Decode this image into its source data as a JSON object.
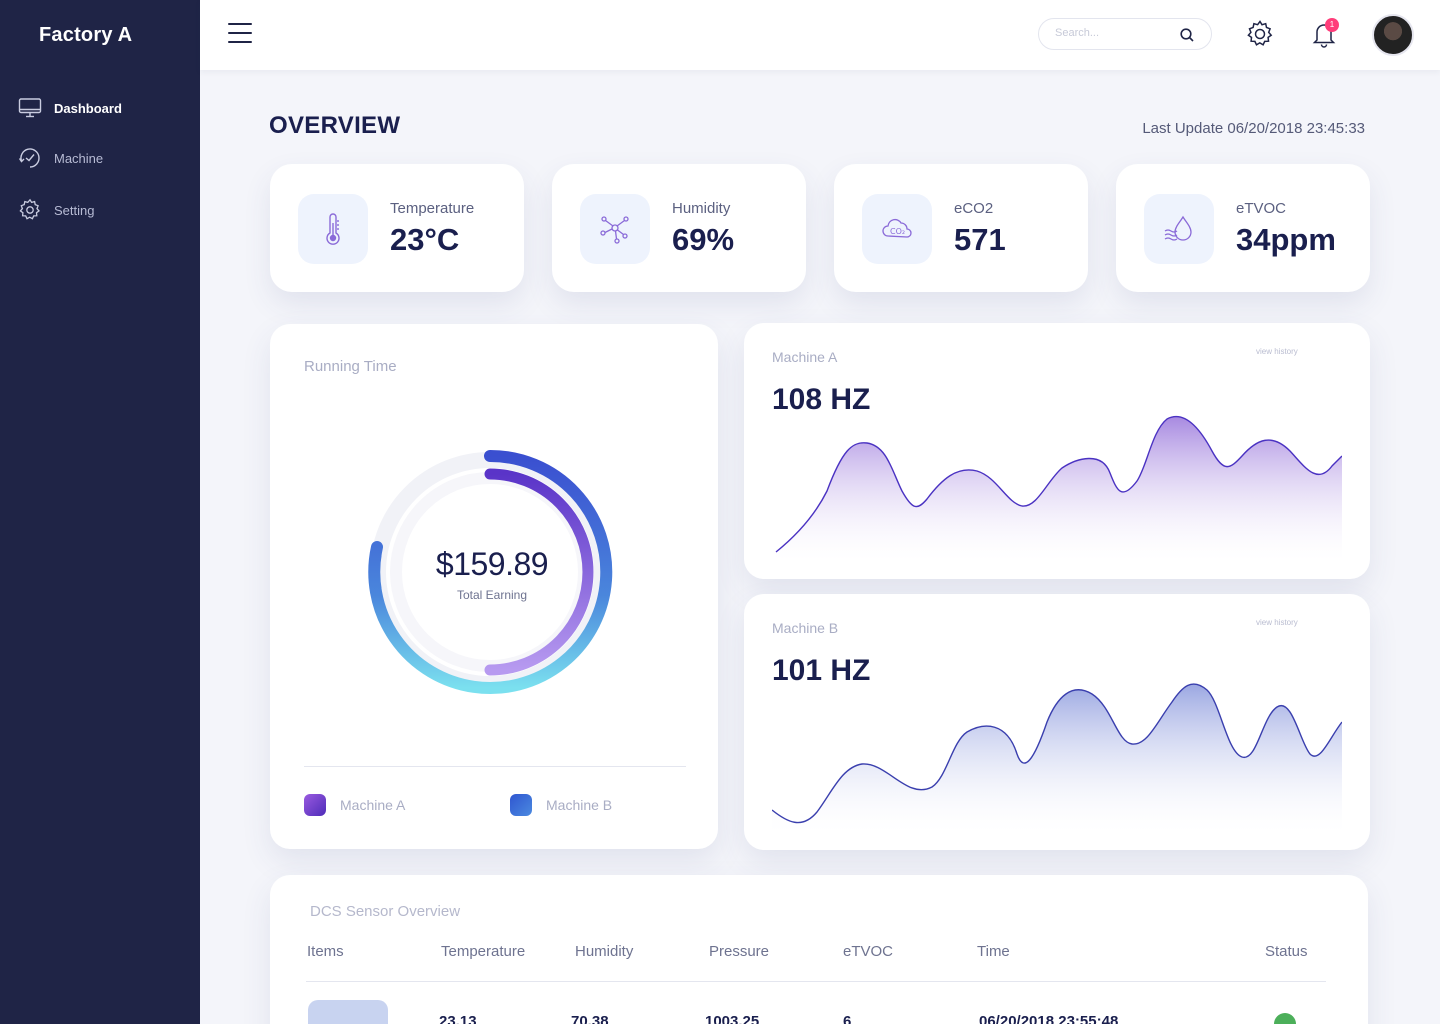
{
  "sidebar": {
    "brand": "Factory A",
    "items": [
      {
        "label": "Dashboard",
        "icon": "monitor-icon",
        "active": true
      },
      {
        "label": "Machine",
        "icon": "gauge-icon",
        "active": false
      },
      {
        "label": "Setting",
        "icon": "gear-icon",
        "active": false
      }
    ]
  },
  "topbar": {
    "search_placeholder": "Search...",
    "notification_count": "1"
  },
  "overview": {
    "title": "OVERVIEW",
    "last_update": "Last Update 06/20/2018 23:45:33"
  },
  "stats": [
    {
      "label": "Temperature",
      "value": "23°C",
      "icon": "thermometer-icon"
    },
    {
      "label": "Humidity",
      "value": "69%",
      "icon": "molecule-icon"
    },
    {
      "label": "eCO2",
      "value": "571",
      "icon": "co2-cloud-icon"
    },
    {
      "label": "eTVOC",
      "value": "34ppm",
      "icon": "water-drop-icon"
    }
  ],
  "running_time": {
    "title": "Running Time",
    "total": "$159.89",
    "total_label": "Total Earning",
    "legend": [
      {
        "label": "Machine A",
        "color": "#7b45d6"
      },
      {
        "label": "Machine B",
        "color": "#3a62d6"
      }
    ],
    "ring_fractions": {
      "outer": 0.83,
      "inner": 0.5
    }
  },
  "machine_a": {
    "title": "Machine A",
    "value": "108 HZ",
    "link": "view history",
    "color": "#6a4fd0"
  },
  "machine_b": {
    "title": "Machine B",
    "value": "101 HZ",
    "link": "view history",
    "color": "#4a5ab8"
  },
  "sensor_table": {
    "title": "DCS Sensor Overview",
    "columns": [
      "Items",
      "Temperature",
      "Humidity",
      "Pressure",
      "eTVOC",
      "Time",
      "Status"
    ],
    "rows": [
      {
        "temperature": "23.13",
        "humidity": "70.38",
        "pressure": "1003.25",
        "etvoc": "6",
        "time": "06/20/2018 23:55:48",
        "status": "ok"
      }
    ]
  }
}
